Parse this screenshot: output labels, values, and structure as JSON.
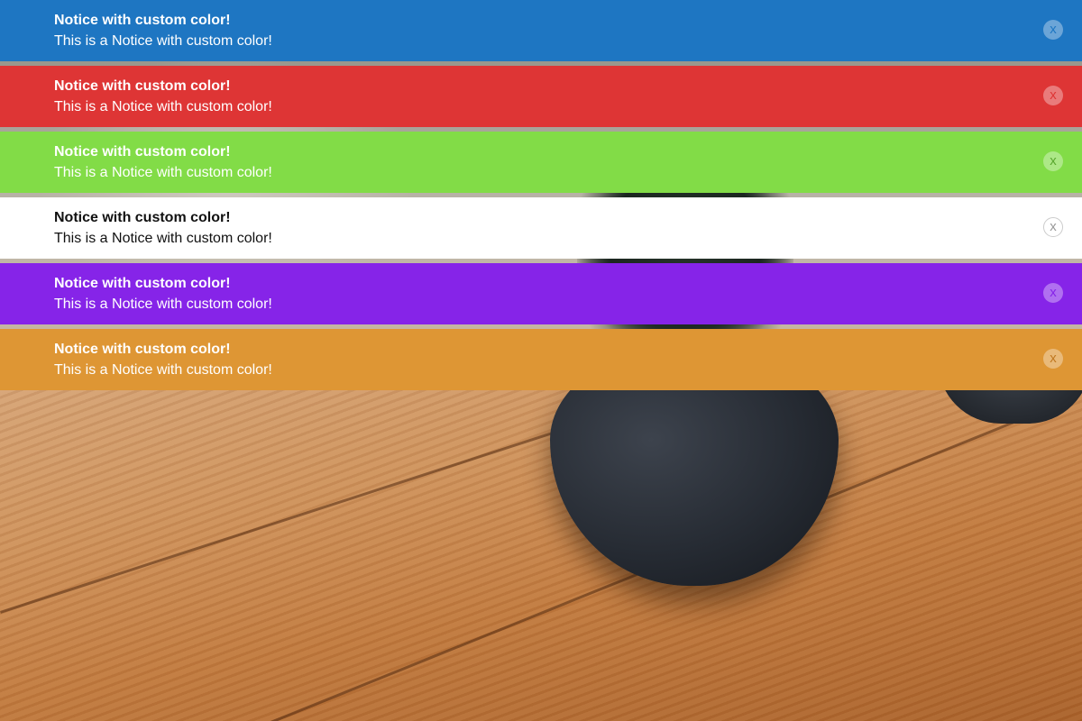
{
  "notices": [
    {
      "title": "Notice with custom color!",
      "text": "This is a Notice with custom color!",
      "close_label": "x",
      "bg": "#1e76c2",
      "fg": "#ffffff",
      "close_bg": "rgba(255,255,255,0.35)",
      "close_fg": "#1e76c2",
      "close_border": "rgba(255,255,255,0)"
    },
    {
      "title": "Notice with custom color!",
      "text": "This is a Notice with custom color!",
      "close_label": "x",
      "bg": "#de3535",
      "fg": "#ffffff",
      "close_bg": "rgba(255,255,255,0.35)",
      "close_fg": "#de3535",
      "close_border": "rgba(255,255,255,0)"
    },
    {
      "title": "Notice with custom color!",
      "text": "This is a Notice with custom color!",
      "close_label": "x",
      "bg": "#82dc47",
      "fg": "#ffffff",
      "close_bg": "rgba(255,255,255,0.35)",
      "close_fg": "#5aa830",
      "close_border": "rgba(255,255,255,0)"
    },
    {
      "title": "Notice with custom color!",
      "text": "This is a Notice with custom color!",
      "close_label": "x",
      "bg": "#ffffff",
      "fg": "#111111",
      "close_bg": "#ffffff",
      "close_fg": "#999999",
      "close_border": "#cccccc"
    },
    {
      "title": "Notice with custom color!",
      "text": "This is a Notice with custom color!",
      "close_label": "x",
      "bg": "#8624e8",
      "fg": "#ffffff",
      "close_bg": "rgba(255,255,255,0.35)",
      "close_fg": "#8624e8",
      "close_border": "rgba(255,255,255,0)"
    },
    {
      "title": "Notice with custom color!",
      "text": "This is a Notice with custom color!",
      "close_label": "x",
      "bg": "#de9634",
      "fg": "#ffffff",
      "close_bg": "rgba(255,255,255,0.35)",
      "close_fg": "#c07820",
      "close_border": "rgba(255,255,255,0)"
    }
  ]
}
